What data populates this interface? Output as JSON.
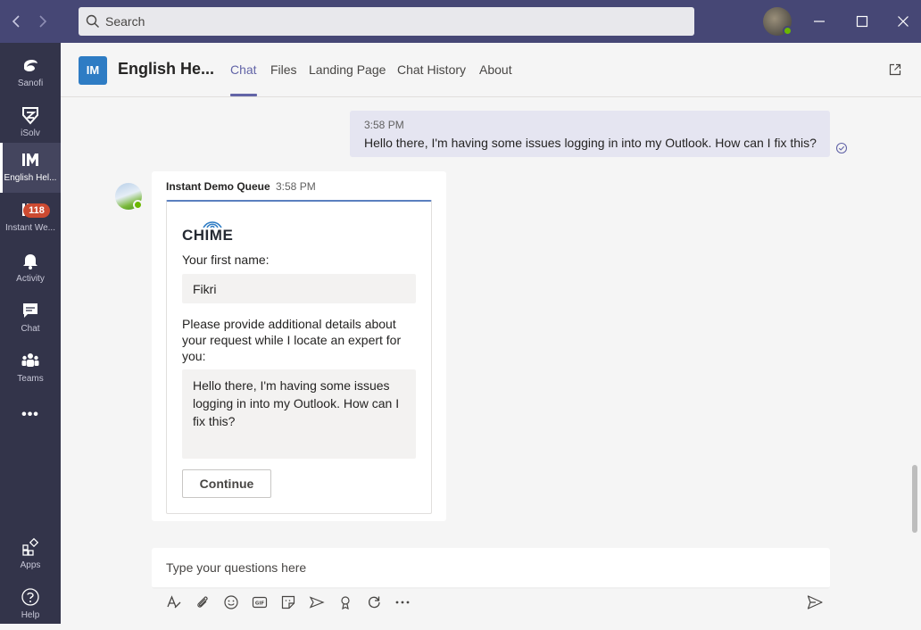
{
  "search": {
    "placeholder": "Search"
  },
  "rail": {
    "items": [
      {
        "label": "Sanofi"
      },
      {
        "label": "iSolv"
      },
      {
        "label": "English Hel..."
      },
      {
        "label": "Instant We..."
      },
      {
        "label": "Activity",
        "badge": "118"
      },
      {
        "label": "Chat"
      },
      {
        "label": "Teams"
      },
      {
        "label": "Apps"
      },
      {
        "label": "Help"
      }
    ],
    "more": "•••"
  },
  "app": {
    "logo": "IM",
    "title": "English He...",
    "tabs": [
      "Chat",
      "Files",
      "Landing Page",
      "Chat History",
      "About"
    ],
    "active_tab": "Chat"
  },
  "messages": {
    "outgoing": {
      "time": "3:58 PM",
      "text": "Hello there, I'm having some issues logging in into my Outlook. How can I fix this?"
    },
    "incoming": {
      "sender": "Instant Demo Queue",
      "time": "3:58 PM",
      "card": {
        "logo": "CHIME",
        "first_name_label": "Your first name:",
        "first_name_value": "Fikri",
        "details_label": "Please provide additional details about your request while I locate an expert for you:",
        "details_value": "Hello there, I'm having some issues logging in into my Outlook. How can I fix this?",
        "continue_label": "Continue"
      }
    }
  },
  "compose": {
    "placeholder": "Type your questions here"
  },
  "colors": {
    "titlebar": "#464775",
    "rail": "#33344a",
    "accent": "#6264a7",
    "badge": "#cc4a31",
    "presence": "#6bb700"
  }
}
